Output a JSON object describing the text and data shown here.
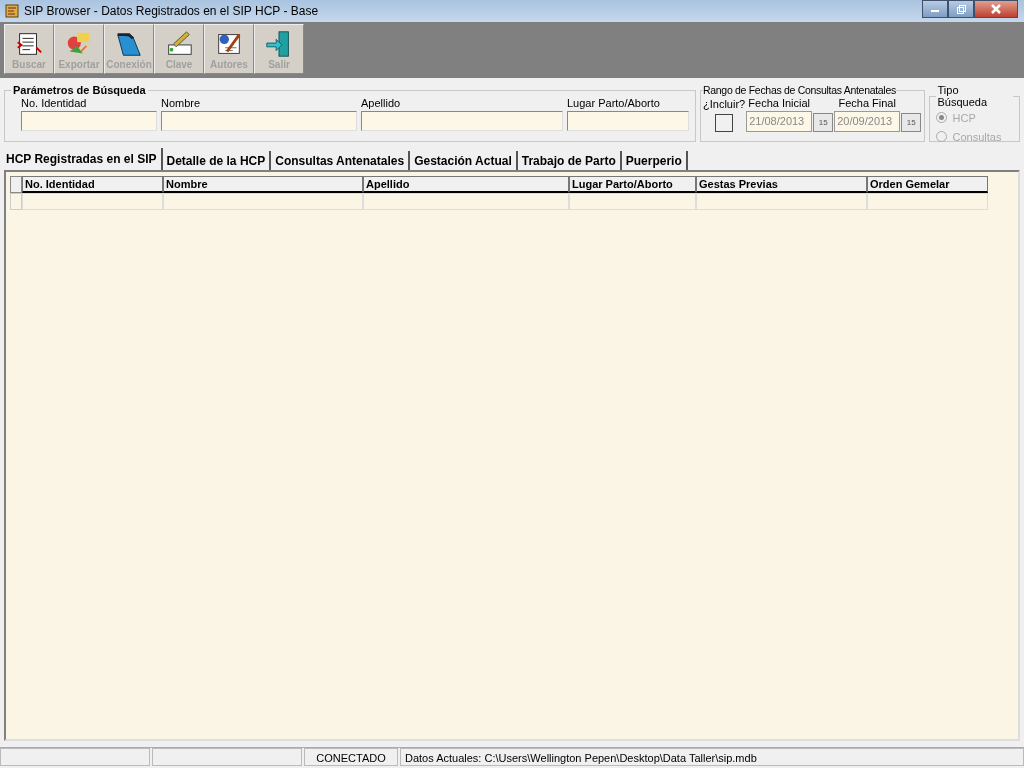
{
  "window": {
    "title": "SIP Browser - Datos Registrados en el SIP HCP - Base"
  },
  "toolbar": [
    {
      "label": "Buscar",
      "kind": "search",
      "disabled": true
    },
    {
      "label": "Exportar",
      "kind": "export",
      "disabled": true
    },
    {
      "label": "Conexión",
      "kind": "folder",
      "disabled": true
    },
    {
      "label": "Clave",
      "kind": "key",
      "disabled": true
    },
    {
      "label": "Autores",
      "kind": "authors",
      "disabled": true
    },
    {
      "label": "Salir",
      "kind": "exit",
      "disabled": true
    }
  ],
  "search_params": {
    "title": "Parámetros de Búsqueda",
    "fields": [
      {
        "label": "No. Identidad"
      },
      {
        "label": "Nombre"
      },
      {
        "label": "Apellido"
      },
      {
        "label": "Lugar Parto/Aborto"
      }
    ]
  },
  "date_range": {
    "title": "Rango de Fechas de Consultas Antenatales",
    "include_label": "¿Incluir?",
    "include_checked": false,
    "start_label": "Fecha Inicial",
    "start_value": "21/08/2013",
    "start_calendar_glyph": "15",
    "end_label": "Fecha Final",
    "end_value": "20/09/2013",
    "end_calendar_glyph": "15",
    "disabled": true
  },
  "search_type": {
    "title": "Tipo Búsqueda",
    "options": [
      {
        "label": "HCP",
        "selected": true,
        "disabled": true
      },
      {
        "label": "Consultas",
        "selected": false,
        "disabled": true
      }
    ]
  },
  "tabs": [
    {
      "label": "HCP Registradas en el SIP",
      "selected": true
    },
    {
      "label": "Detalle de la HCP",
      "selected": false
    },
    {
      "label": "Consultas Antenatales",
      "selected": false
    },
    {
      "label": "Gestación Actual",
      "selected": false
    },
    {
      "label": "Trabajo de Parto",
      "selected": false
    },
    {
      "label": "Puerperio",
      "selected": false
    }
  ],
  "table": {
    "columns": [
      "No. Identidad",
      "Nombre",
      "Apellido",
      "Lugar Parto/Aborto",
      "Gestas Previas",
      "Orden Gemelar"
    ]
  },
  "status_bar": {
    "connection": "CONECTADO",
    "current_data": "Datos Actuales: C:\\Users\\Wellington Pepen\\Desktop\\Data Taller\\sip.mdb"
  }
}
